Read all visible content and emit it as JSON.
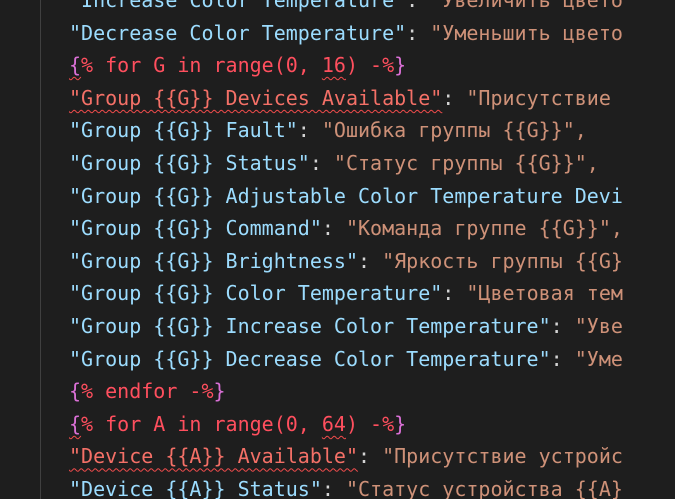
{
  "lines": [
    {
      "type": "kv",
      "key": "\"Increase Color Temperature\"",
      "val": "\"Увеличить цвето"
    },
    {
      "type": "kv",
      "key": "\"Decrease Color Temperature\"",
      "val": "\"Уменьшить цвето"
    },
    {
      "type": "tag",
      "open": "{",
      "text": "% for G in range(0, ",
      "num": "16",
      "text2": ") -%",
      "close": "}"
    },
    {
      "type": "kverr",
      "key": "\"Group {{G}} Devices Available\"",
      "val": "\"Присутствие"
    },
    {
      "type": "kv",
      "key": "\"Group {{G}} Fault\"",
      "val": "\"Ошибка группы {{G}}\","
    },
    {
      "type": "kv",
      "key": "\"Group {{G}} Status\"",
      "val": "\"Статус группы {{G}}\","
    },
    {
      "type": "key",
      "key": "\"Group {{G}} Adjustable Color Temperature Devi"
    },
    {
      "type": "kv",
      "key": "\"Group {{G}} Command\"",
      "val": "\"Команда группе {{G}}\","
    },
    {
      "type": "kv",
      "key": "\"Group {{G}} Brightness\"",
      "val": "\"Яркость группы {{G}"
    },
    {
      "type": "kv",
      "key": "\"Group {{G}} Color Temperature\"",
      "val": "\"Цветовая тем"
    },
    {
      "type": "kv",
      "key": "\"Group {{G}} Increase Color Temperature\"",
      "val": "\"Уве"
    },
    {
      "type": "kv",
      "key": "\"Group {{G}} Decrease Color Temperature\"",
      "val": "\"Уме"
    },
    {
      "type": "endtag",
      "open": "{",
      "text": "% endfor -%",
      "close": "}"
    },
    {
      "type": "tag",
      "open": "{",
      "text": "% for A in range(0, ",
      "num": "64",
      "text2": ") -%",
      "close": "}"
    },
    {
      "type": "kverr",
      "key": "\"Device {{A}} Available\"",
      "val": "\"Присутствие устройс"
    },
    {
      "type": "kv",
      "key": "\"Device {{A}} Status\"",
      "val": "\"Статус устройства {{A}"
    }
  ],
  "colors": {
    "background": "#1e1e1e",
    "key": "#9cdcfe",
    "value": "#ce9178",
    "template_tag": "#ff4f5e",
    "brace": "#da70d6",
    "error_underline": "#f14c4c"
  }
}
